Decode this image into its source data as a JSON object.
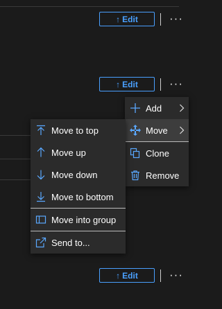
{
  "rows": [
    {
      "edit_label": "Edit",
      "edit_arrow": "↑",
      "more": "···"
    },
    {
      "edit_label": "Edit",
      "edit_arrow": "↑",
      "more": "···"
    },
    {
      "edit_label": "Edit",
      "edit_arrow": "↑",
      "more": "···"
    }
  ],
  "context_menu": {
    "add": "Add",
    "move": "Move",
    "clone": "Clone",
    "remove": "Remove"
  },
  "move_submenu": {
    "move_to_top": "Move to top",
    "move_up": "Move up",
    "move_down": "Move down",
    "move_to_bottom": "Move to bottom",
    "move_into_group": "Move into group",
    "send_to": "Send to..."
  },
  "colors": {
    "background": "#1b1b1b",
    "menu_bg": "#2b2b2b",
    "accent": "#4aa0ff",
    "icon_blue": "#5aa8ff"
  }
}
